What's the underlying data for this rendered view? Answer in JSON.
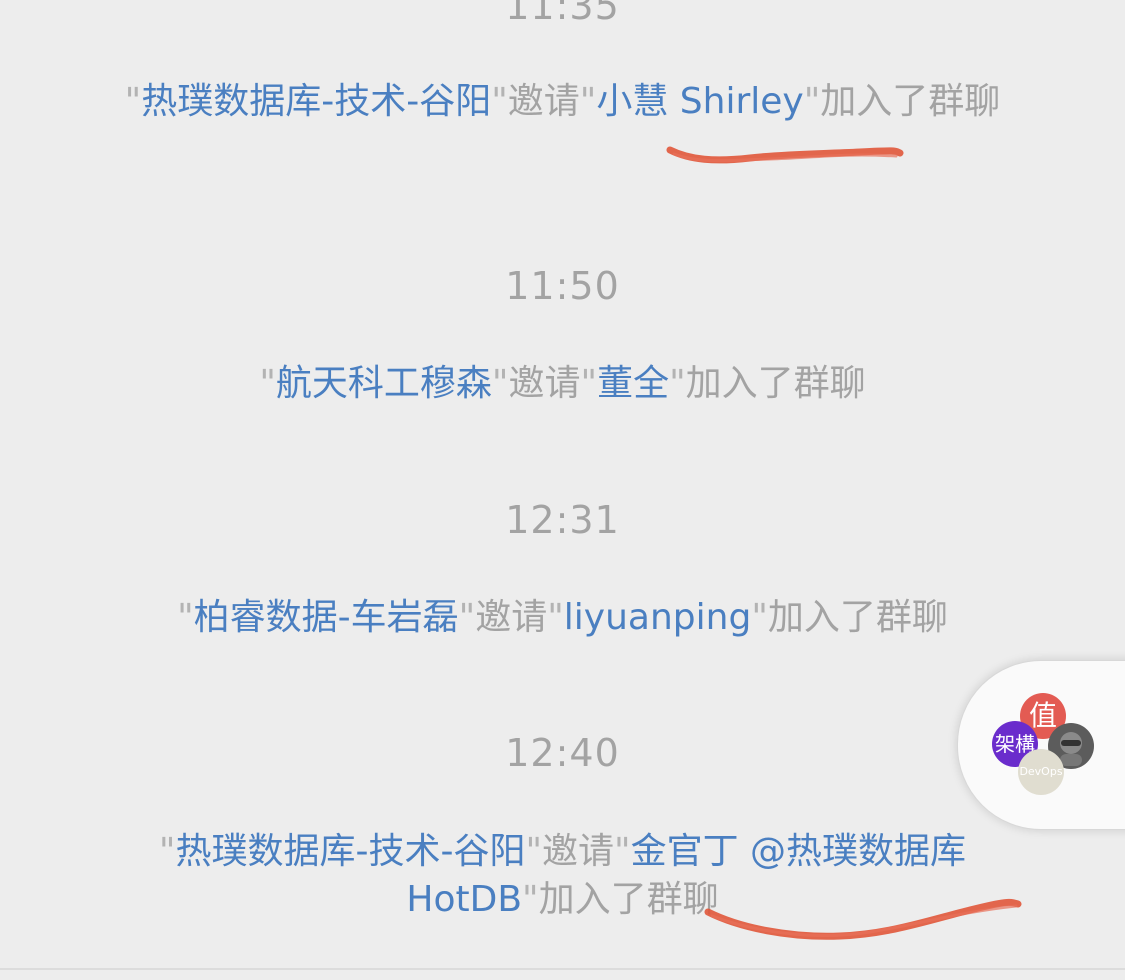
{
  "messages": [
    {
      "time": "11:35",
      "inviter": "热璞数据库-技术-谷阳",
      "verb": "邀请",
      "invitee": "小慧 Shirley",
      "suffix": "加入了群聊"
    },
    {
      "time": "11:50",
      "inviter": "航天科工穆森",
      "verb": "邀请",
      "invitee": "董全",
      "suffix": "加入了群聊"
    },
    {
      "time": "12:31",
      "inviter": "柏睿数据-车岩磊",
      "verb": "邀请",
      "invitee": "liyuanping",
      "suffix": "加入了群聊"
    },
    {
      "time": "12:40",
      "inviter": "热璞数据库-技术-谷阳",
      "verb": "邀请",
      "invitee": "金官丁 @热璞数据库 HotDB",
      "suffix": "加入了群聊"
    }
  ],
  "floating_window": {
    "avatars": [
      "值",
      "架構",
      "DevOps"
    ]
  },
  "colors": {
    "background": "#ededed",
    "system_text": "#a3a3a3",
    "name_link": "#4a7fc1",
    "annotation": "#e0563a"
  }
}
